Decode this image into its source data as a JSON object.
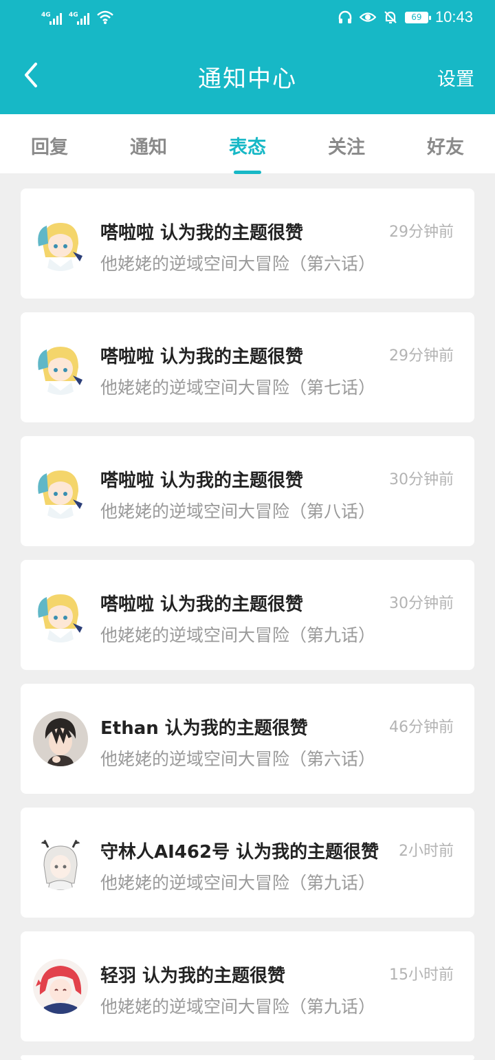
{
  "status_bar": {
    "signal1_label": "4G",
    "signal2_label": "4G",
    "battery": "69",
    "time": "10:43",
    "icons": [
      "headphones-icon",
      "eye-icon",
      "bell-off-icon",
      "battery-icon",
      "wifi-icon"
    ]
  },
  "header": {
    "title": "通知中心",
    "settings_label": "设置",
    "back_icon": "chevron-left-icon"
  },
  "tabs": [
    {
      "label": "回复"
    },
    {
      "label": "通知"
    },
    {
      "label": "表态",
      "active": true
    },
    {
      "label": "关注"
    },
    {
      "label": "好友"
    }
  ],
  "notifications": [
    {
      "user": "嗒啦啦",
      "action": "认为我的主题很赞",
      "title": "嗒啦啦 认为我的主题很赞",
      "subject": "他姥姥的逆域空间大冒险（第六话）",
      "time": "29分钟前",
      "avatar": "blonde-anime-girl"
    },
    {
      "user": "嗒啦啦",
      "action": "认为我的主题很赞",
      "title": "嗒啦啦 认为我的主题很赞",
      "subject": "他姥姥的逆域空间大冒险（第七话）",
      "time": "29分钟前",
      "avatar": "blonde-anime-girl"
    },
    {
      "user": "嗒啦啦",
      "action": "认为我的主题很赞",
      "title": "嗒啦啦 认为我的主题很赞",
      "subject": "他姥姥的逆域空间大冒险（第八话）",
      "time": "30分钟前",
      "avatar": "blonde-anime-girl"
    },
    {
      "user": "嗒啦啦",
      "action": "认为我的主题很赞",
      "title": "嗒啦啦 认为我的主题很赞",
      "subject": "他姥姥的逆域空间大冒险（第九话）",
      "time": "30分钟前",
      "avatar": "blonde-anime-girl"
    },
    {
      "user": "Ethan",
      "action": "认为我的主题很赞",
      "title": "Ethan 认为我的主题很赞",
      "subject": "他姥姥的逆域空间大冒险（第六话）",
      "time": "46分钟前",
      "avatar": "dark-haired-anime-boy"
    },
    {
      "user": "守林人AI462号",
      "action": "认为我的主题很赞",
      "title": "守林人AI462号 认为我的主题很赞",
      "subject": "他姥姥的逆域空间大冒险（第九话）",
      "time": "2小时前",
      "avatar": "white-haired-antler-girl"
    },
    {
      "user": "轻羽",
      "action": "认为我的主题很赞",
      "title": "轻羽 认为我的主题很赞",
      "subject": "他姥姥的逆域空间大冒险（第九话）",
      "time": "15小时前",
      "avatar": "red-haired-anime-girl"
    }
  ],
  "colors": {
    "accent": "#17b8c6",
    "background": "#efefef",
    "card": "#ffffff",
    "title_text": "#222222",
    "secondary_text": "#9a9a9a",
    "time_text": "#b3b3b3",
    "inactive_tab": "#8a8a8a"
  }
}
